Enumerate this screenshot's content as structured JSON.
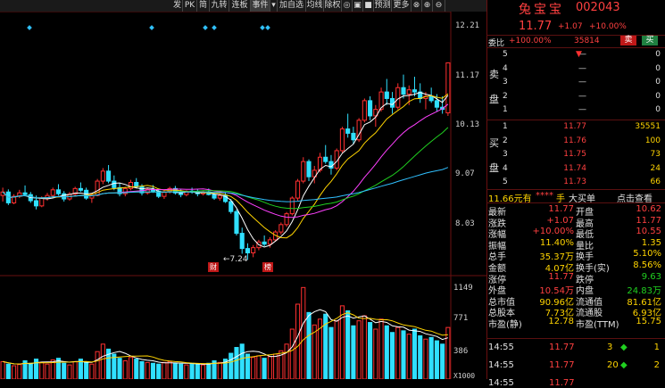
{
  "toolbar": {
    "items": [
      "发",
      "PK",
      "简",
      "九转",
      "连板",
      "事件",
      "▾",
      "加自选",
      "均线",
      "除权",
      "◎",
      "▣",
      "■",
      "预测",
      "更多",
      "⊗",
      "⊕",
      "⊖"
    ]
  },
  "stock": {
    "name": "兔宝宝",
    "code": "002043",
    "price": "11.77",
    "change": "+1.07",
    "change_pct": "+10.00%"
  },
  "weibi": {
    "label": "委比",
    "value": "+100.00%",
    "vol": "35814",
    "sell_btn": "卖",
    "buy_btn": "买"
  },
  "sell_book": [
    {
      "level": "5",
      "price": "—",
      "vol": "0"
    },
    {
      "level": "4",
      "price": "—",
      "vol": "0"
    },
    {
      "level": "3",
      "price": "—",
      "vol": "0"
    },
    {
      "level": "2",
      "price": "—",
      "vol": "0"
    },
    {
      "level": "1",
      "price": "—",
      "vol": "0"
    }
  ],
  "sell_side_label": [
    "卖",
    "盘"
  ],
  "buy_side_label": [
    "买",
    "盘"
  ],
  "buy_book": [
    {
      "level": "1",
      "price": "11.77",
      "vol": "35551"
    },
    {
      "level": "2",
      "price": "11.76",
      "vol": "100"
    },
    {
      "level": "3",
      "price": "11.75",
      "vol": "73"
    },
    {
      "level": "4",
      "price": "11.74",
      "vol": "24"
    },
    {
      "level": "5",
      "price": "11.73",
      "vol": "66"
    }
  ],
  "big_order": {
    "left": "11.66元有",
    "mask": "****",
    "unit": "手",
    "middle": "大买单",
    "right": "点击查看"
  },
  "stats": [
    {
      "l1": "最新",
      "v1": "11.77",
      "l2": "开盘",
      "v2": "10.62"
    },
    {
      "l1": "涨跌",
      "v1": "+1.07",
      "l2": "最高",
      "v2": "11.77"
    },
    {
      "l1": "涨幅",
      "v1": "+10.00%",
      "l2": "最低",
      "v2": "10.55"
    },
    {
      "l1": "振幅",
      "v1": "11.40%",
      "l2": "量比",
      "v2": "1.35"
    },
    {
      "l1": "总手",
      "v1": "35.37万",
      "l2": "换手",
      "v2": "5.10%"
    },
    {
      "l1": "金额",
      "v1": "4.07亿",
      "l2": "换手(实)",
      "v2": "8.56%"
    },
    {
      "l1": "涨停",
      "v1": "11.77",
      "l2": "跌停",
      "v2": "9.63"
    },
    {
      "l1": "外盘",
      "v1": "10.54万",
      "l2": "内盘",
      "v2": "24.83万"
    },
    {
      "l1": "总市值",
      "v1": "90.96亿",
      "l2": "流通值",
      "v2": "81.61亿"
    },
    {
      "l1": "总股本",
      "v1": "7.73亿",
      "l2": "流通股",
      "v2": "6.93亿"
    },
    {
      "l1": "市盈(静)",
      "v1": "12.78",
      "l2": "市盈(TTM)",
      "v2": "15.75"
    }
  ],
  "ticks": [
    {
      "time": "14:55",
      "price": "11.77",
      "vol": "3",
      "arrow": "◆",
      "cnt": "1"
    },
    {
      "time": "14:55",
      "price": "11.77",
      "vol": "20",
      "arrow": "◆",
      "cnt": "2"
    },
    {
      "time": "14:55",
      "price": "11.77",
      "vol": "",
      "arrow": "",
      "cnt": ""
    }
  ],
  "axis": {
    "price_ticks": [
      "12.21",
      "11.17",
      "10.13",
      "9.07",
      "8.03"
    ],
    "vol_ticks": [
      "1149",
      "771",
      "386",
      "X1000"
    ]
  },
  "annotations": {
    "low_label": "←7.24",
    "marker1": "财",
    "marker2": "榜"
  },
  "colors": {
    "up": "#ff3030",
    "down": "#30e0ff",
    "ma5": "#ffffff",
    "ma10": "#ffd400",
    "ma20": "#ff40ff",
    "ma30": "#20d020",
    "ma60": "#30c0ff"
  },
  "chart_data": {
    "type": "candlestick",
    "ohlc": [
      [
        8.72,
        8.9,
        8.58,
        8.8
      ],
      [
        8.8,
        8.86,
        8.5,
        8.55
      ],
      [
        8.55,
        8.75,
        8.52,
        8.7
      ],
      [
        8.7,
        8.85,
        8.66,
        8.78
      ],
      [
        8.78,
        8.95,
        8.7,
        8.74
      ],
      [
        8.74,
        8.8,
        8.55,
        8.6
      ],
      [
        8.6,
        8.72,
        8.4,
        8.48
      ],
      [
        8.48,
        8.7,
        8.45,
        8.66
      ],
      [
        8.66,
        8.78,
        8.6,
        8.72
      ],
      [
        8.72,
        8.9,
        8.68,
        8.85
      ],
      [
        8.85,
        8.98,
        8.72,
        8.76
      ],
      [
        8.76,
        8.82,
        8.58,
        8.64
      ],
      [
        8.64,
        8.8,
        8.6,
        8.75
      ],
      [
        8.75,
        8.92,
        8.7,
        8.88
      ],
      [
        8.88,
        9.02,
        8.8,
        8.84
      ],
      [
        8.84,
        8.9,
        8.62,
        8.66
      ],
      [
        8.66,
        8.78,
        8.55,
        8.72
      ],
      [
        8.72,
        9.1,
        8.7,
        9.05
      ],
      [
        9.05,
        9.35,
        8.98,
        9.28
      ],
      [
        9.28,
        9.42,
        9.0,
        9.05
      ],
      [
        9.05,
        9.18,
        8.84,
        8.9
      ],
      [
        8.9,
        9.0,
        8.7,
        8.76
      ],
      [
        8.76,
        8.92,
        8.7,
        8.88
      ],
      [
        8.88,
        9.08,
        8.84,
        9.02
      ],
      [
        9.02,
        9.12,
        8.88,
        8.92
      ],
      [
        8.92,
        8.98,
        8.72,
        8.78
      ],
      [
        8.78,
        8.9,
        8.74,
        8.86
      ],
      [
        8.86,
        8.96,
        8.78,
        8.82
      ],
      [
        8.82,
        8.88,
        8.66,
        8.7
      ],
      [
        8.7,
        8.84,
        8.64,
        8.8
      ],
      [
        8.8,
        8.92,
        8.76,
        8.88
      ],
      [
        8.88,
        8.94,
        8.74,
        8.78
      ],
      [
        8.78,
        8.86,
        8.68,
        8.74
      ],
      [
        8.74,
        8.84,
        8.7,
        8.82
      ],
      [
        8.82,
        8.9,
        8.76,
        8.8
      ],
      [
        8.8,
        8.86,
        8.7,
        8.76
      ],
      [
        8.76,
        8.84,
        8.72,
        8.8
      ],
      [
        8.8,
        8.88,
        8.72,
        8.74
      ],
      [
        8.74,
        8.8,
        8.62,
        8.66
      ],
      [
        8.66,
        8.76,
        8.6,
        8.72
      ],
      [
        8.72,
        8.78,
        8.55,
        8.58
      ],
      [
        8.58,
        8.64,
        8.3,
        8.35
      ],
      [
        8.35,
        8.4,
        7.8,
        7.85
      ],
      [
        7.85,
        7.98,
        7.38,
        7.5
      ],
      [
        7.5,
        7.62,
        7.24,
        7.4
      ],
      [
        7.4,
        7.58,
        7.3,
        7.52
      ],
      [
        7.52,
        7.7,
        7.46,
        7.65
      ],
      [
        7.65,
        7.8,
        7.55,
        7.6
      ],
      [
        7.6,
        7.76,
        7.52,
        7.7
      ],
      [
        7.7,
        7.92,
        7.66,
        7.88
      ],
      [
        7.88,
        8.1,
        7.82,
        8.05
      ],
      [
        8.05,
        8.34,
        8.0,
        8.3
      ],
      [
        8.3,
        8.7,
        8.26,
        8.66
      ],
      [
        8.66,
        9.1,
        8.6,
        9.05
      ],
      [
        9.05,
        9.6,
        9.0,
        9.5
      ],
      [
        9.5,
        9.55,
        9.05,
        9.15
      ],
      [
        9.15,
        9.4,
        9.0,
        9.3
      ],
      [
        9.3,
        9.7,
        9.25,
        9.6
      ],
      [
        9.6,
        9.88,
        9.45,
        9.5
      ],
      [
        9.5,
        9.65,
        9.2,
        9.35
      ],
      [
        9.35,
        9.8,
        9.3,
        9.75
      ],
      [
        9.75,
        10.3,
        9.7,
        10.25
      ],
      [
        10.25,
        10.6,
        10.05,
        10.15
      ],
      [
        10.15,
        10.3,
        9.9,
        10.0
      ],
      [
        10.0,
        10.5,
        9.95,
        10.45
      ],
      [
        10.45,
        10.95,
        10.4,
        10.9
      ],
      [
        10.9,
        11.0,
        10.45,
        10.55
      ],
      [
        10.55,
        10.8,
        10.3,
        10.7
      ],
      [
        10.7,
        11.2,
        10.65,
        11.1
      ],
      [
        11.1,
        11.4,
        10.8,
        10.95
      ],
      [
        10.95,
        11.1,
        10.6,
        10.75
      ],
      [
        10.75,
        11.3,
        10.7,
        11.2
      ],
      [
        11.2,
        11.5,
        10.95,
        11.05
      ],
      [
        11.05,
        11.25,
        10.8,
        11.15
      ],
      [
        11.15,
        11.45,
        11.0,
        11.1
      ],
      [
        11.1,
        11.3,
        10.85,
        10.95
      ],
      [
        10.95,
        11.1,
        10.7,
        11.0
      ],
      [
        11.0,
        11.2,
        10.85,
        10.9
      ],
      [
        10.9,
        11.05,
        10.65,
        10.75
      ],
      [
        10.75,
        11.0,
        10.6,
        10.7
      ],
      [
        10.62,
        11.77,
        10.55,
        11.77
      ]
    ],
    "price_range": [
      7.0,
      12.6
    ],
    "volume": [
      210,
      180,
      160,
      175,
      220,
      190,
      240,
      200,
      180,
      230,
      250,
      190,
      170,
      210,
      240,
      200,
      180,
      330,
      420,
      360,
      300,
      250,
      220,
      260,
      240,
      210,
      200,
      190,
      180,
      200,
      210,
      190,
      180,
      170,
      190,
      180,
      170,
      190,
      220,
      200,
      240,
      310,
      380,
      420,
      300,
      260,
      280,
      250,
      270,
      300,
      340,
      420,
      600,
      900,
      1100,
      800,
      650,
      720,
      780,
      620,
      700,
      880,
      820,
      640,
      700,
      760,
      680,
      600,
      720,
      640,
      560,
      620,
      580,
      540,
      600,
      520,
      480,
      500,
      460,
      420,
      620
    ],
    "volume_range": [
      0,
      1200
    ]
  }
}
